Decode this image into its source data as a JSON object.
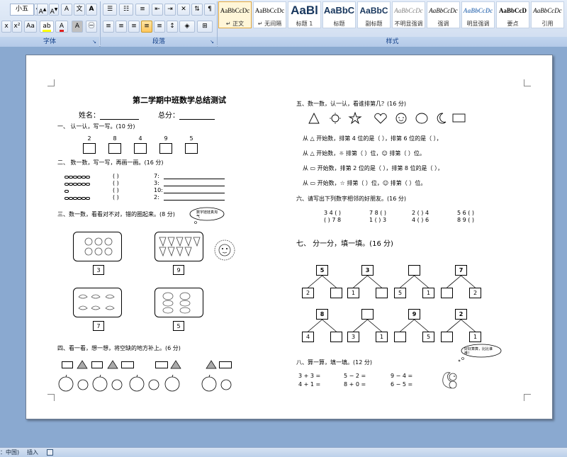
{
  "ribbon": {
    "font_size_value": "小五",
    "font_group_label": "字体",
    "paragraph_group_label": "段落",
    "styles_group_label": "样式",
    "font_buttons": [
      "A",
      "A",
      "ab",
      "wén",
      "A"
    ],
    "font_buttons_row2": [
      "x₂",
      "x²",
      "Aa",
      "ab",
      "A",
      "A",
      "字"
    ],
    "styles": [
      {
        "sample": "AaBbCcDc",
        "name": "↵ 正文"
      },
      {
        "sample": "AaBbCcDc",
        "name": "↵ 无间隔"
      },
      {
        "sample": "AaBl",
        "name": "标题 1"
      },
      {
        "sample": "AaBbC",
        "name": "标题"
      },
      {
        "sample": "AaBbC",
        "name": "副标题"
      },
      {
        "sample": "AaBbCcDc",
        "name": "不明显强调"
      },
      {
        "sample": "AaBbCcDc",
        "name": "强调"
      },
      {
        "sample": "AaBbCcDc",
        "name": "明显强调"
      },
      {
        "sample": "AaBbCcD",
        "name": "要点"
      },
      {
        "sample": "AaBbCcDc",
        "name": "引用"
      }
    ]
  },
  "doc": {
    "title": "第二学期中班数学总结测试",
    "name_label": "姓名：",
    "score_label": "总分：",
    "q1": "一、  认一认，写一写。(10 分)",
    "q1_numbers": [
      "2",
      "8",
      "4",
      "9",
      "5"
    ],
    "q2": "二、  数一数，写一写，再画一画。(16 分)",
    "q2_paren": "(    )",
    "q2_rows": [
      "7:",
      "3:",
      "10:",
      "2:"
    ],
    "q3": "三、数一数，看看对不对，错的圈起来。(8 分)",
    "q3_bubble": "数字娃娃真淘气",
    "q3_labels": [
      "3",
      "9",
      "7",
      "5"
    ],
    "q4": "四、看一看，想一想，将空缺的地方补上。(6 分)",
    "q5": "五、数一数，认一认，看谁排第几？(16 分)",
    "q5_lines": [
      "从 △ 开始数，排第 4 位的是（      ），排第 6 位的是（      ），",
      "从 △ 开始数，☼ 排第（    ）位，☺ 排第（    ）位。",
      "从 ▭ 开始数，排第 2 位的是（      ），排第 8 位的是（      ），",
      "从 ▭ 开始数，☆ 排第（    ）位，☺ 排第（    ）位。"
    ],
    "q6": "六、请写出下列数字相邻的好朋友。(16 分)",
    "q6_row1": [
      "3 4 (   )",
      "7 8 (   )",
      "2 (   ) 4",
      "5 6 (   )"
    ],
    "q6_row2": [
      "(   ) 7 8",
      "1 (   ) 3",
      "4 (   ) 6",
      "8 9 (   )"
    ],
    "q7": "七、  分一分，填一填。(16 分)",
    "q7_trees": [
      {
        "top": "5",
        "left": "2",
        "right": ""
      },
      {
        "top": "3",
        "left": "1",
        "right": ""
      },
      {
        "top": "",
        "left": "5",
        "right": "1"
      },
      {
        "top": "7",
        "left": "",
        "right": "2"
      },
      {
        "top": "8",
        "left": "4",
        "right": ""
      },
      {
        "top": "",
        "left": "3",
        "right": "1"
      },
      {
        "top": "9",
        "left": "",
        "right": "5"
      },
      {
        "top": "2",
        "left": "",
        "right": "1"
      }
    ],
    "q8": "八、算一算，填一填。(12 分)",
    "q8_bubble": "好好算算，比比谁棒！",
    "q8_col1": [
      "3 + 3 =",
      "4 + 1 ="
    ],
    "q8_col2": [
      "5 − 2 =",
      "8 + 0 ="
    ],
    "q8_col3": [
      "9 − 4 =",
      "6 − 5 ="
    ]
  },
  "status": {
    "language": "：中国)",
    "insert_mode": "插入"
  }
}
